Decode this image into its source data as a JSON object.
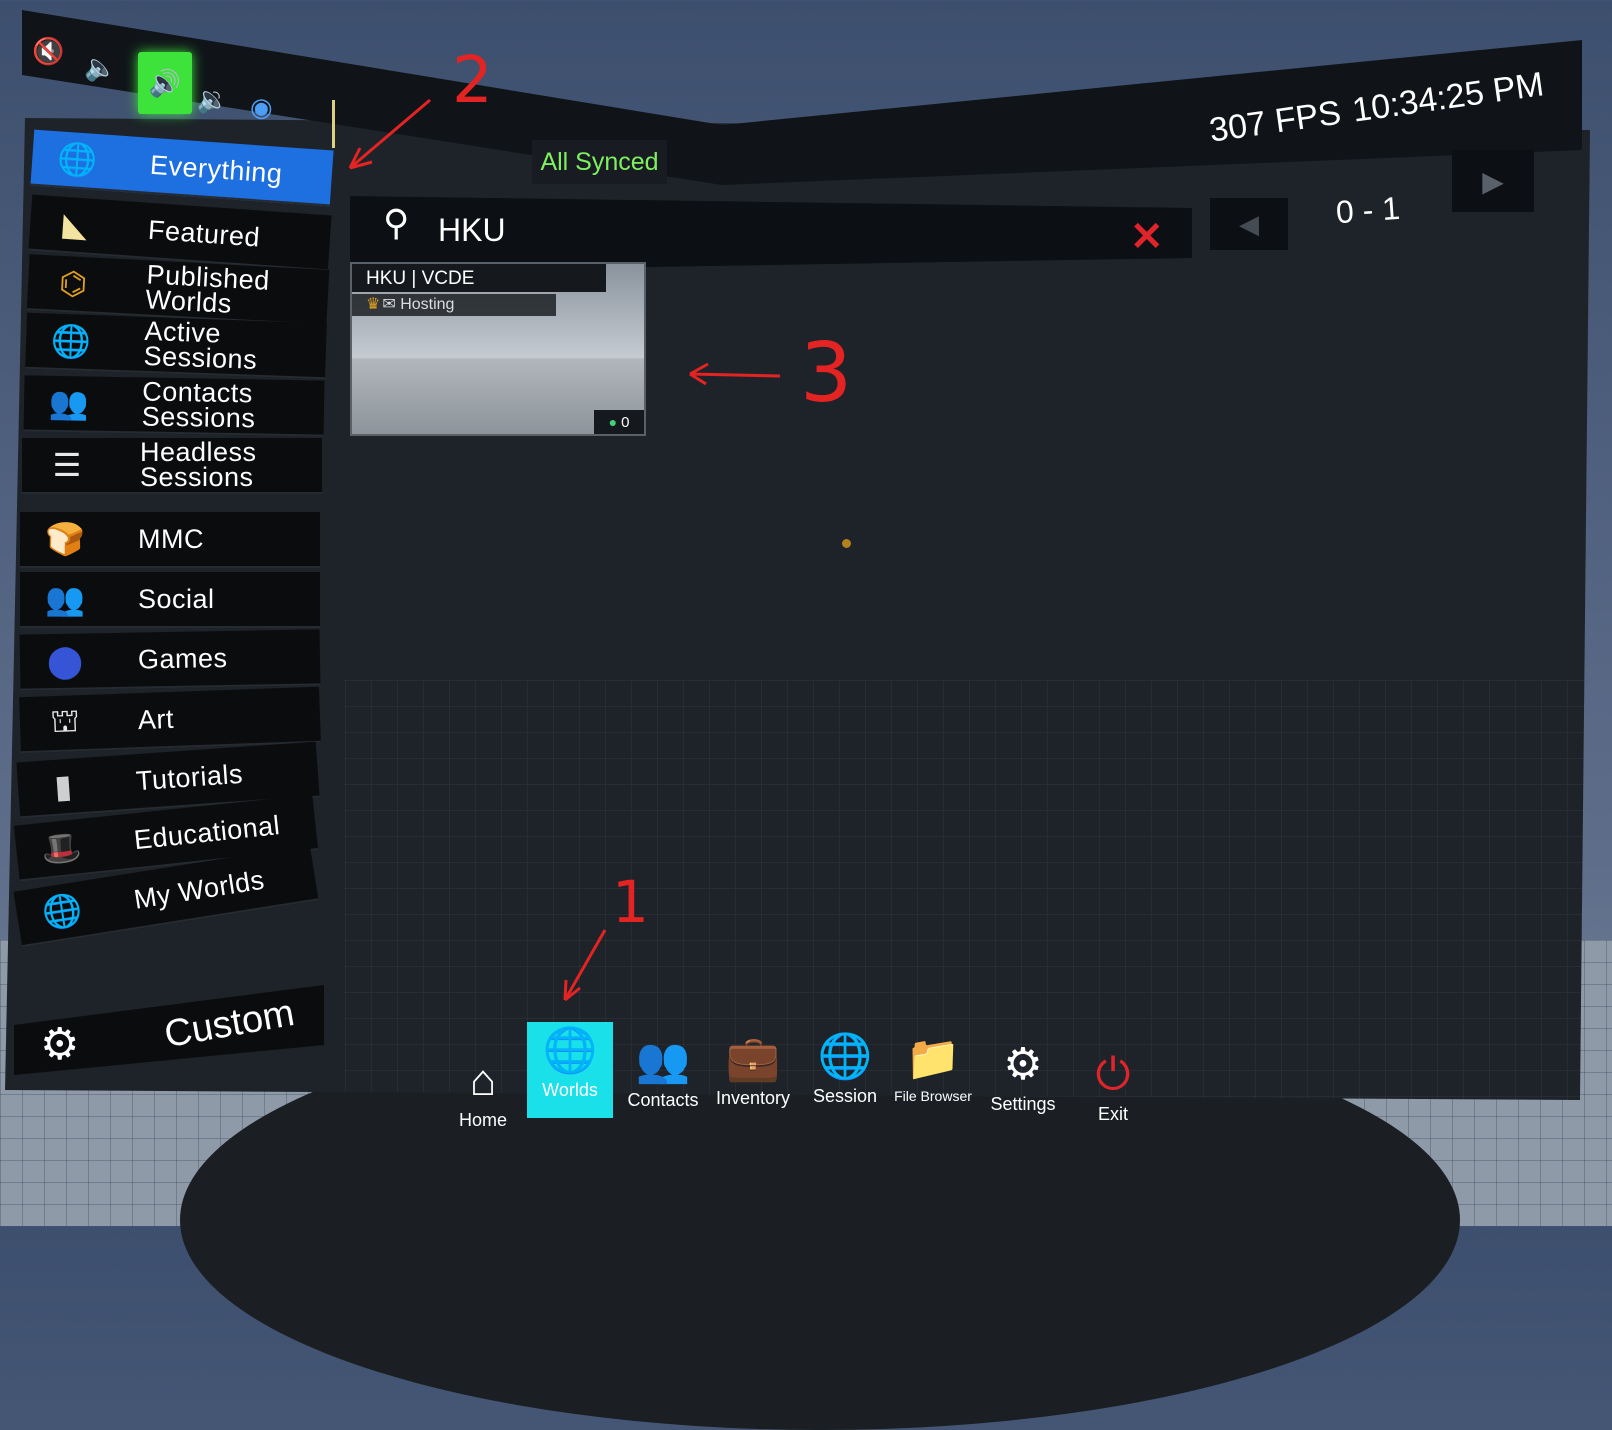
{
  "status": {
    "sync_label": "All Synced",
    "fps": "307 FPS",
    "clock": "10:34:25 PM"
  },
  "audio_modes": [
    "muted-icon",
    "push-to-talk-icon",
    "voice-active-icon",
    "broadcast-icon",
    "radio-icon"
  ],
  "sidebar": {
    "items": [
      {
        "label": "Everything",
        "icon": "globe-icon",
        "active": true
      },
      {
        "label": "Featured",
        "icon": "wedge-icon"
      },
      {
        "label": "Published\nWorlds",
        "icon": "network-icon"
      },
      {
        "label": "Active\nSessions",
        "icon": "globe-gear-icon"
      },
      {
        "label": "Contacts\nSessions",
        "icon": "contacts-icon"
      },
      {
        "label": "Headless\nSessions",
        "icon": "server-icon"
      },
      {
        "label": "MMC",
        "icon": "toast-icon"
      },
      {
        "label": "Social",
        "icon": "social-icon"
      },
      {
        "label": "Games",
        "icon": "helmet-icon"
      },
      {
        "label": "Art",
        "icon": "easel-icon"
      },
      {
        "label": "Tutorials",
        "icon": "pillar-icon"
      },
      {
        "label": "Educational",
        "icon": "hat-icon"
      },
      {
        "label": "My Worlds",
        "icon": "my-worlds-icon"
      }
    ],
    "custom_label": "Custom"
  },
  "search": {
    "value": "HKU"
  },
  "pager": {
    "range": "0 - 1"
  },
  "world_card": {
    "title": "HKU | VCDE",
    "host_status": "Hosting",
    "user_count": "0"
  },
  "dock": {
    "items": [
      {
        "label": "Home",
        "icon": "home-icon"
      },
      {
        "label": "Worlds",
        "icon": "globe-icon",
        "active": true
      },
      {
        "label": "Contacts",
        "icon": "contacts-icon"
      },
      {
        "label": "Inventory",
        "icon": "briefcase-icon"
      },
      {
        "label": "Session",
        "icon": "globe-gear-icon"
      },
      {
        "label": "File Browser",
        "icon": "folder-icon"
      },
      {
        "label": "Settings",
        "icon": "gear-icon"
      },
      {
        "label": "Exit",
        "icon": "power-icon"
      }
    ]
  },
  "annotations": {
    "one": "1",
    "two": "2",
    "three": "3"
  },
  "colors": {
    "active_tab": "#1e6fe0",
    "active_dock": "#1ae0ea",
    "synced": "#7ef05f",
    "annotation": "#e42323"
  }
}
